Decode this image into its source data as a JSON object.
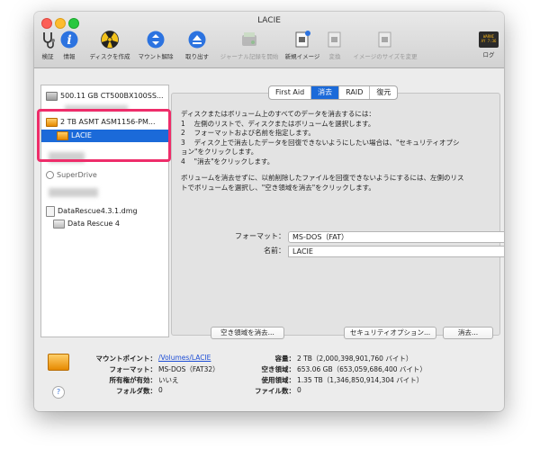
{
  "window": {
    "title": "LACIE"
  },
  "toolbar": [
    {
      "label": "検証",
      "icon": "stethoscope-icon",
      "enabled": true
    },
    {
      "label": "情報",
      "icon": "info-icon",
      "enabled": true
    },
    {
      "label": "ディスクを作成",
      "icon": "burn-icon",
      "enabled": true
    },
    {
      "label": "マウント解除",
      "icon": "unmount-icon",
      "enabled": true
    },
    {
      "label": "取り出す",
      "icon": "eject-icon",
      "enabled": true
    },
    {
      "label": "ジャーナル記録を開始",
      "icon": "journal-icon",
      "enabled": false
    },
    {
      "label": "新規イメージ",
      "icon": "new-image-icon",
      "enabled": true
    },
    {
      "label": "変換",
      "icon": "convert-icon",
      "enabled": false
    },
    {
      "label": "イメージのサイズを変更",
      "icon": "resize-image-icon",
      "enabled": false
    },
    {
      "label": "ログ",
      "icon": "log-icon",
      "enabled": true
    }
  ],
  "log_icon_text": "WARNI\nAY 7:36",
  "sidebar": {
    "disk1": "500.11 GB CT500BX100SS...",
    "disk2": "2 TB ASMT ASM1156-PM...",
    "volume": "LACIE",
    "superdrive": "SuperDrive",
    "dmg": "DataRescue4.3.1.dmg",
    "dmg_volume": "Data Rescue 4"
  },
  "tabs": [
    "First Aid",
    "消去",
    "RAID",
    "復元"
  ],
  "active_tab_index": 1,
  "instructions": {
    "lines": [
      "ディスクまたはボリューム上のすべてのデータを消去するには：",
      "1　 左側のリストで、ディスクまたはボリュームを選択します。",
      "2　 フォーマットおよび名前を指定します。",
      "3　 ディスク上で消去したデータを回復できないようにしたい場合は、\"セキュリティオプシ",
      "ョン\"をクリックします。",
      "4　 \"消去\"をクリックします。"
    ],
    "free_space_lines": [
      "ボリュームを消去せずに、以前削除したファイルを回復できないようにするには、左側のリス",
      "トでボリュームを選択し、\"空き領域を消去\"をクリックします。"
    ]
  },
  "form": {
    "format_label": "フォーマット：",
    "format_value": "MS-DOS（FAT）",
    "name_label": "名前：",
    "name_value": "LACIE"
  },
  "buttons": {
    "erase_free_space": "空き領域を消去...",
    "security_options": "セキュリティオプション...",
    "erase": "消去..."
  },
  "info": {
    "mount_point_key": "マウントポイント：",
    "mount_point_val": "/Volumes/LACIE",
    "format_key": "フォーマット：",
    "format_val": "MS-DOS（FAT32）",
    "owners_key": "所有権が有効：",
    "owners_val": "いいえ",
    "folders_key": "フォルダ数：",
    "folders_val": "0",
    "capacity_key": "容量：",
    "capacity_val": "2 TB（2,000,398,901,760 バイト）",
    "available_key": "空き領域：",
    "available_val": "653.06 GB（653,059,686,400 バイト）",
    "used_key": "使用領域：",
    "used_val": "1.35 TB（1,346,850,914,304 バイト）",
    "files_key": "ファイル数：",
    "files_val": "0"
  },
  "help_symbol": "?",
  "colors": {
    "accent": "#1b6ad9",
    "highlight": "#ee2d6a",
    "link": "#1f4fd6"
  }
}
